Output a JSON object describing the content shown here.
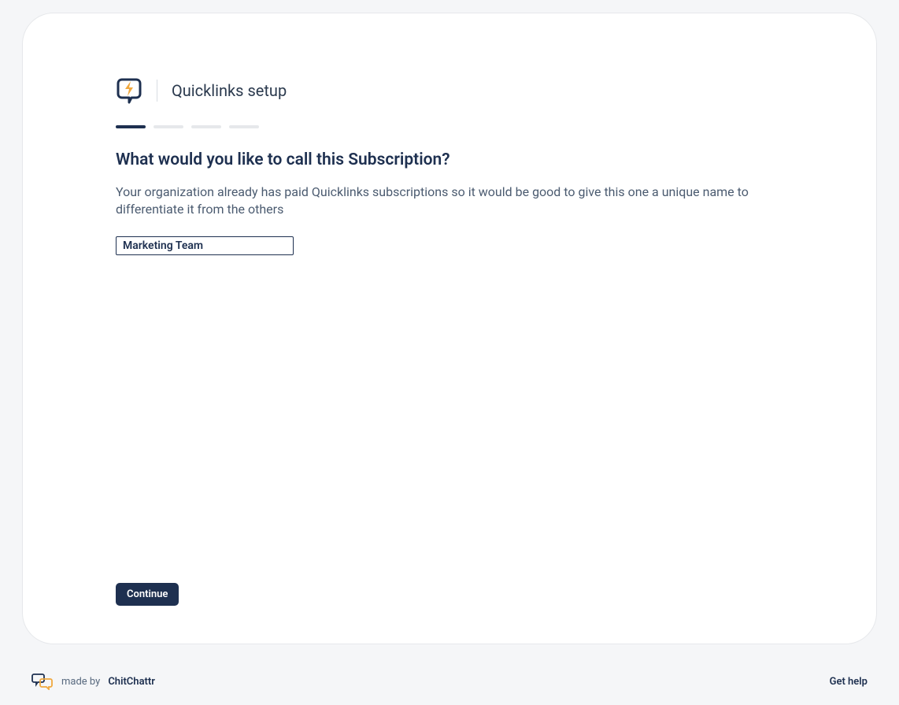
{
  "header": {
    "title": "Quicklinks setup"
  },
  "progress": {
    "total": 4,
    "active": 1
  },
  "main": {
    "heading": "What would you like to call this Subscription?",
    "description": "Your organization already has paid Quicklinks subscriptions so it would be good to give this one a unique name to differentiate it from the others",
    "input_value": "Marketing Team"
  },
  "actions": {
    "continue_label": "Continue"
  },
  "footer": {
    "made_by": "made by",
    "brand": "ChitChattr",
    "help_label": "Get help"
  },
  "colors": {
    "primary": "#1e3050",
    "accent": "#f0a83e",
    "background": "#f5f6f8",
    "card": "#ffffff",
    "text_muted": "#4b5b70",
    "inactive": "#e6e8eb"
  }
}
